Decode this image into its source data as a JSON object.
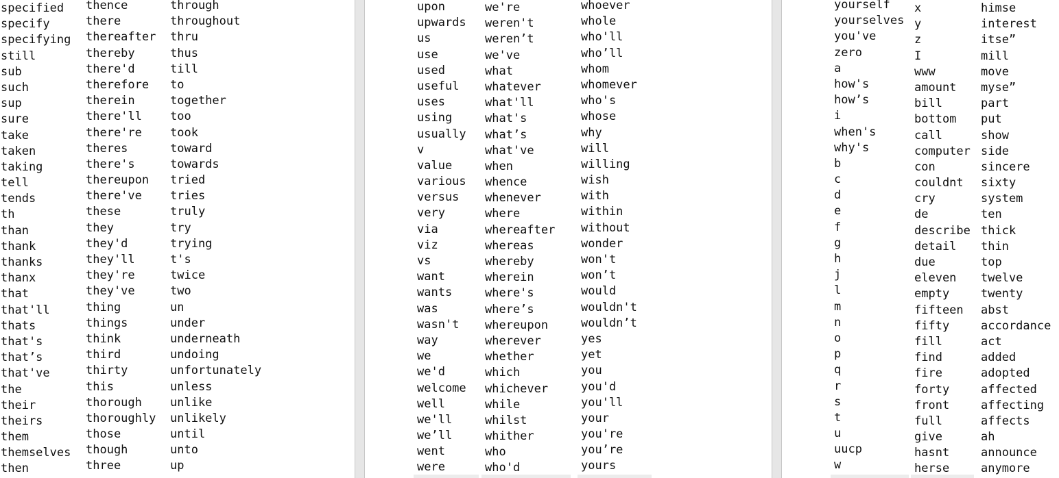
{
  "panels": [
    {
      "columns": [
        [
          "specified",
          "specify",
          "specifying",
          "still",
          "sub",
          "such",
          "sup",
          "sure",
          "take",
          "taken",
          "taking",
          "tell",
          "tends",
          "th",
          "than",
          "thank",
          "thanks",
          "thanx",
          "that",
          "that'll",
          "thats",
          "that's",
          "that’s",
          "that've",
          "the",
          "their",
          "theirs",
          "them",
          "themselves",
          "then"
        ],
        [
          "thence",
          "there",
          "thereafter",
          "thereby",
          "there'd",
          "therefore",
          "therein",
          "there'll",
          "there're",
          "theres",
          "there's",
          "thereupon",
          "there've",
          "these",
          "they",
          "they'd",
          "they'll",
          "they're",
          "they've",
          "thing",
          "things",
          "think",
          "third",
          "thirty",
          "this",
          "thorough",
          "thoroughly",
          "those",
          "though",
          "three"
        ],
        [
          "through",
          "throughout",
          "thru",
          "thus",
          "till",
          "to",
          "together",
          "too",
          "took",
          "toward",
          "towards",
          "tried",
          "tries",
          "truly",
          "try",
          "trying",
          "t's",
          "twice",
          "two",
          "un",
          "under",
          "underneath",
          "undoing",
          "unfortunately",
          "unless",
          "unlike",
          "unlikely",
          "until",
          "unto",
          "up"
        ]
      ]
    },
    {
      "columns": [
        [
          "upon",
          "upwards",
          "us",
          "use",
          "used",
          "useful",
          "uses",
          "using",
          "usually",
          "v",
          "value",
          "various",
          "versus",
          "very",
          "via",
          "viz",
          "vs",
          "want",
          "wants",
          "was",
          "wasn't",
          "way",
          "we",
          "we'd",
          "welcome",
          "well",
          "we'll",
          "we’ll",
          "went",
          "were"
        ],
        [
          "we're",
          "weren't",
          "weren’t",
          "we've",
          "what",
          "whatever",
          "what'll",
          "what's",
          "what’s",
          "what've",
          "when",
          "whence",
          "whenever",
          "where",
          "whereafter",
          "whereas",
          "whereby",
          "wherein",
          "where's",
          "where’s",
          "whereupon",
          "wherever",
          "whether",
          "which",
          "whichever",
          "while",
          "whilst",
          "whither",
          "who",
          "who'd"
        ],
        [
          "whoever",
          "whole",
          "who'll",
          "who’ll",
          "whom",
          "whomever",
          "who's",
          "whose",
          "why",
          "will",
          "willing",
          "wish",
          "with",
          "within",
          "without",
          "wonder",
          "won't",
          "won’t",
          "would",
          "wouldn't",
          "wouldn’t",
          "yes",
          "yet",
          "you",
          "you'd",
          "you'll",
          "your",
          "you're",
          "you’re",
          "yours"
        ]
      ]
    },
    {
      "columns": [
        [
          "yourself",
          "yourselves",
          "you've",
          "zero",
          "a",
          "how's",
          "how’s",
          "i",
          "when's",
          "why's",
          "b",
          "c",
          "d",
          "e",
          "f",
          "g",
          "h",
          "j",
          "l",
          "m",
          "n",
          "o",
          "p",
          "q",
          "r",
          "s",
          "t",
          "u",
          "uucp",
          "w"
        ],
        [
          "x",
          "y",
          "z",
          "I",
          "www",
          "amount",
          "bill",
          "bottom",
          "call",
          "computer",
          "con",
          "couldnt",
          "cry",
          "de",
          "describe",
          "detail",
          "due",
          "eleven",
          "empty",
          "fifteen",
          "fifty",
          "fill",
          "find",
          "fire",
          "forty",
          "front",
          "full",
          "give",
          "hasnt",
          "herse"
        ],
        [
          "himse",
          "interest",
          "itse”",
          "mill",
          "move",
          "myse”",
          "part",
          "put",
          "show",
          "side",
          "sincere",
          "sixty",
          "system",
          "ten",
          "thick",
          "thin",
          "top",
          "twelve",
          "twenty",
          "abst",
          "accordance",
          "act",
          "added",
          "adopted",
          "affected",
          "affecting",
          "affects",
          "ah",
          "announce",
          "anymore"
        ]
      ]
    }
  ]
}
